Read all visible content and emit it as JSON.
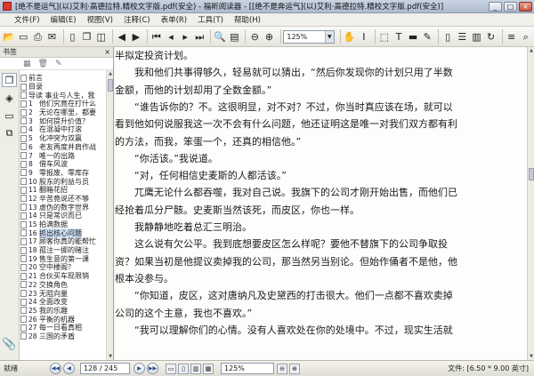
{
  "window": {
    "title": "[绝不是运气](以)艾利·高德拉特.精校文字版.pdf(安全) - 福昕阅读器 - [[绝不是奔运气](以)艾利·高德拉特.精校文字版.pdf(安全)]",
    "controls": {
      "minimize": "_",
      "maximize": "□",
      "close": "×"
    }
  },
  "menu": [
    "文件(F)",
    "编辑(E)",
    "视图(V)",
    "注释(C)",
    "表单(R)",
    "工具(T)",
    "帮助(H)"
  ],
  "toolbar": {
    "icons": [
      "open-folder-icon",
      "save-icon",
      "print-icon",
      "email-icon",
      "blank-page-icon",
      "pages-icon",
      "convert-icon",
      "back-arrow-icon",
      "forward-arrow-icon",
      "first-page-icon",
      "prev-page-icon",
      "next-page-icon",
      "last-page-icon",
      "magnifier-icon",
      "page-thumbnail-icon",
      "zoom-out-icon",
      "zoom-in-icon",
      "hand-tool-icon",
      "text-select-icon",
      "snapshot-icon",
      "typewriter-icon",
      "highlight-icon",
      "note-icon",
      "single-page-icon",
      "continuous-icon",
      "facing-icon",
      "rotate-icon",
      "reflow-icon",
      "search-icon"
    ],
    "glyphs": [
      "📂",
      "▭",
      "⎙",
      "✉",
      "▯",
      "❐",
      "◫",
      "◀",
      "▶",
      "⏮",
      "◂",
      "▸",
      "⏭",
      "🔍",
      "▤",
      "⊖",
      "⊕",
      "✋",
      "I",
      "⬚",
      "T",
      "▬",
      "✎",
      "▯",
      "☰",
      "▥",
      "↻",
      "≡",
      "⌕"
    ],
    "zoom_value": "125%"
  },
  "sidebar": {
    "title": "书签",
    "close": "×",
    "tools": [
      "▦",
      "🗑",
      "✎"
    ],
    "tabs": [
      "❐",
      "◈",
      "▭",
      "⧉"
    ],
    "bookmarks": [
      {
        "num": "",
        "text": "前言"
      },
      {
        "num": "",
        "text": "目录"
      },
      {
        "num": "",
        "text": "导读  事业与人生，我"
      },
      {
        "num": "1",
        "text": "他们究竟在打什么"
      },
      {
        "num": "2",
        "text": "无论在哪里，都要"
      },
      {
        "num": "3",
        "text": "如何提升价值？"
      },
      {
        "num": "4",
        "text": "在混凝中打滚"
      },
      {
        "num": "5",
        "text": "化冲突为双赢"
      },
      {
        "num": "6",
        "text": "老友再度并肩作战"
      },
      {
        "num": "7",
        "text": "唯一的出路"
      },
      {
        "num": "8",
        "text": "借车风波"
      },
      {
        "num": "9",
        "text": "零报废、零库存"
      },
      {
        "num": "10",
        "text": "股东的利益与员"
      },
      {
        "num": "11",
        "text": "翻箱花招"
      },
      {
        "num": "12",
        "text": "辛苦竟说还不够"
      },
      {
        "num": "13",
        "text": "虚伪的数字世界"
      },
      {
        "num": "14",
        "text": "只是常识而已"
      },
      {
        "num": "15",
        "text": "拍满数据"
      },
      {
        "num": "16",
        "text": "抓出核心问题"
      },
      {
        "num": "17",
        "text": "顾客你真的能帮忙"
      },
      {
        "num": "18",
        "text": "孤注一掷的赌注"
      },
      {
        "num": "19",
        "text": "售生意的第一课"
      },
      {
        "num": "20",
        "text": "空中楼阁？"
      },
      {
        "num": "21",
        "text": "合伙买车现限销"
      },
      {
        "num": "22",
        "text": "交换角色"
      },
      {
        "num": "23",
        "text": "无阻向量"
      },
      {
        "num": "24",
        "text": "全面改变"
      },
      {
        "num": "25",
        "text": "我的乐趣"
      },
      {
        "num": "26",
        "text": "平衡的机器"
      },
      {
        "num": "27",
        "text": "每一日看真相"
      },
      {
        "num": "28",
        "text": "三国的矛盾"
      }
    ],
    "selected_index": 18
  },
  "document": {
    "lines": [
      {
        "text": "半拟定投资计划。",
        "indent": false
      },
      {
        "text": "我和他们共事得够久，轻易就可以猜出，“然后你发现你的计划只用了半数",
        "indent": true
      },
      {
        "text": "金额，而他的计划却用了全数金额。”",
        "indent": false
      },
      {
        "text": "“谁告诉你的？不。这很明显，对不对？不过，你当时真应该在场，就可以",
        "indent": true
      },
      {
        "text": "看到他如何说服我这一次不会有什么问题，他还证明这是唯一对我们双方都有利",
        "indent": false
      },
      {
        "text": "的方法，而我，笨蛋一个，还真的相信他。”",
        "indent": false
      },
      {
        "text": "“你活该。”我说道。",
        "indent": true
      },
      {
        "text": "“对，任何相信史麦斯的人都活该。”",
        "indent": true
      },
      {
        "text": "兀鹰无论什么都吞噬，我对自己说。我旗下的公司才刚开始出售，而他们已",
        "indent": true
      },
      {
        "text": "经抢着瓜分尸骸。史麦斯当然该死，而皮区，你也一样。",
        "indent": false
      },
      {
        "text": "我静静地吃着总汇三明治。",
        "indent": true
      },
      {
        "text": "这么说有欠公平。我到底想要皮区怎么样呢？要他不替旗下的公司争取投",
        "indent": true
      },
      {
        "text": "资？如果当初是他提议卖掉我的公司，那当然另当别论。但始作俑者不是他，他",
        "indent": false
      },
      {
        "text": "根本没参与。",
        "indent": false
      },
      {
        "text": "“你知道，皮区，这对唐纳凡及史黛西的打击很大。他们一点都不喜欢卖掉",
        "indent": true
      },
      {
        "text": "公司的这个主意，我也不喜欢。”",
        "indent": false
      },
      {
        "text": "“我可以理解你们的心情。没有人喜欢处在你的处境中。不过，现实生活就",
        "indent": true
      }
    ]
  },
  "status": {
    "ready": "就绪",
    "nav": [
      "◀◀",
      "◀",
      "▶",
      "▶▶"
    ],
    "page": "128 / 245",
    "view_icons": [
      "▭",
      "▯",
      "▥",
      "▦"
    ],
    "zoom": "125%",
    "zoom_icons": [
      "⊖",
      "⊕"
    ],
    "file_info": "文件: [6.50 * 9.00 英寸]"
  },
  "colors": {
    "title_bar": "#b9c6d8",
    "selection": "#cfe0f6",
    "page_bg": "#fdfdfb",
    "nav_blue": "#2a4d8a"
  }
}
